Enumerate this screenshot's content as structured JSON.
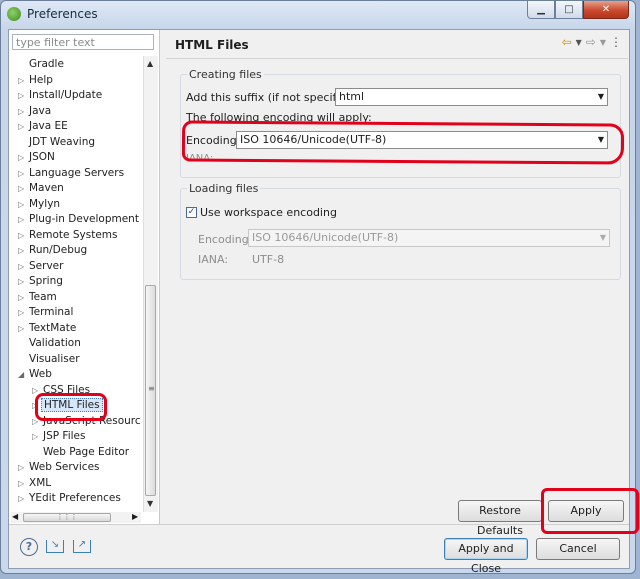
{
  "window": {
    "title": "Preferences"
  },
  "filter": {
    "placeholder": "type filter text"
  },
  "tree": [
    {
      "label": "Gradle",
      "arrow": ""
    },
    {
      "label": "Help",
      "arrow": "▷"
    },
    {
      "label": "Install/Update",
      "arrow": "▷"
    },
    {
      "label": "Java",
      "arrow": "▷"
    },
    {
      "label": "Java EE",
      "arrow": "▷"
    },
    {
      "label": "JDT Weaving",
      "arrow": ""
    },
    {
      "label": "JSON",
      "arrow": "▷"
    },
    {
      "label": "Language Servers",
      "arrow": "▷"
    },
    {
      "label": "Maven",
      "arrow": "▷"
    },
    {
      "label": "Mylyn",
      "arrow": "▷"
    },
    {
      "label": "Plug-in Development",
      "arrow": "▷"
    },
    {
      "label": "Remote Systems",
      "arrow": "▷"
    },
    {
      "label": "Run/Debug",
      "arrow": "▷"
    },
    {
      "label": "Server",
      "arrow": "▷"
    },
    {
      "label": "Spring",
      "arrow": "▷"
    },
    {
      "label": "Team",
      "arrow": "▷"
    },
    {
      "label": "Terminal",
      "arrow": "▷"
    },
    {
      "label": "TextMate",
      "arrow": "▷"
    },
    {
      "label": "Validation",
      "arrow": ""
    },
    {
      "label": "Visualiser",
      "arrow": ""
    },
    {
      "label": "Web",
      "arrow": "◢"
    },
    {
      "label": "CSS Files",
      "arrow": "▷",
      "child": true
    },
    {
      "label": "HTML Files",
      "arrow": "▷",
      "child": true,
      "selected": true
    },
    {
      "label": "JavaScript Resources Too",
      "arrow": "▷",
      "child": true
    },
    {
      "label": "JSP Files",
      "arrow": "▷",
      "child": true
    },
    {
      "label": "Web Page Editor",
      "arrow": "",
      "child": true
    },
    {
      "label": "Web Services",
      "arrow": "▷"
    },
    {
      "label": "XML",
      "arrow": "▷"
    },
    {
      "label": "YEdit Preferences",
      "arrow": "▷"
    }
  ],
  "page": {
    "title": "HTML Files",
    "creating": {
      "legend": "Creating files",
      "suffix_label": "Add this suffix (if not specified):",
      "suffix_value": "html",
      "encoding_note": "The following encoding will apply:",
      "encoding_label": "Encoding:",
      "encoding_value": "ISO 10646/Unicode(UTF-8)",
      "iana_label": "IANA:"
    },
    "loading": {
      "legend": "Loading files",
      "workspace_label": "Use workspace encoding",
      "workspace_checked": true,
      "encoding_label": "Encoding:",
      "encoding_value": "ISO 10646/Unicode(UTF-8)",
      "iana_label": "IANA:",
      "iana_value": "UTF-8"
    },
    "restore_defaults": "Restore Defaults",
    "apply": "Apply"
  },
  "footer": {
    "apply_close": "Apply and Close",
    "cancel": "Cancel"
  },
  "colors": {
    "highlight": "#e3001b",
    "selection": "#d7e7fb"
  }
}
